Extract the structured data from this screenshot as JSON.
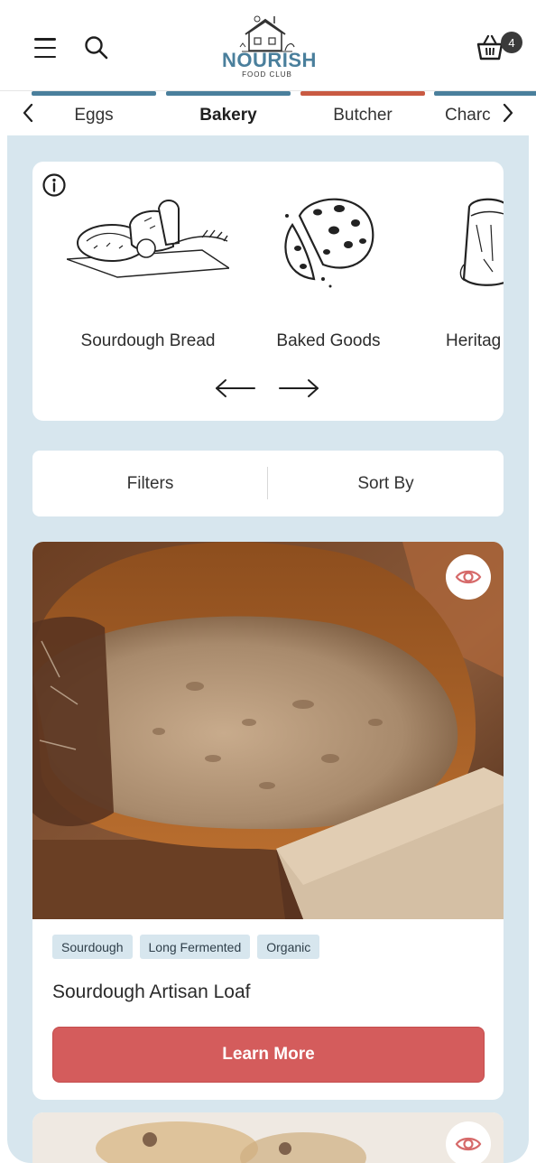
{
  "header": {
    "brand_name": "NOURISH",
    "brand_tagline": "FOOD CLUB",
    "cart_count": "4"
  },
  "tabs": [
    {
      "label": "Eggs",
      "color": "#4a7f9c"
    },
    {
      "label": "Bakery",
      "color": "#4a7f9c",
      "active": true
    },
    {
      "label": "Butcher",
      "color": "#c95a42"
    },
    {
      "label": "Charc",
      "color": "#4a7f9c"
    }
  ],
  "categories": [
    {
      "label": "Sourdough Bread",
      "icon": "bread-illustration-icon"
    },
    {
      "label": "Baked Goods",
      "icon": "cookie-illustration-icon"
    },
    {
      "label": "Heritag",
      "icon": "flour-sack-illustration-icon"
    }
  ],
  "filter_bar": {
    "filters_label": "Filters",
    "sort_label": "Sort By"
  },
  "product": {
    "tags": [
      "Sourdough",
      "Long Fermented",
      "Organic"
    ],
    "title": "Sourdough Artisan Loaf",
    "button_label": "Learn More"
  },
  "colors": {
    "accent_blue": "#4a7f9c",
    "accent_red": "#d45c5c",
    "background": "#d7e6ee"
  }
}
